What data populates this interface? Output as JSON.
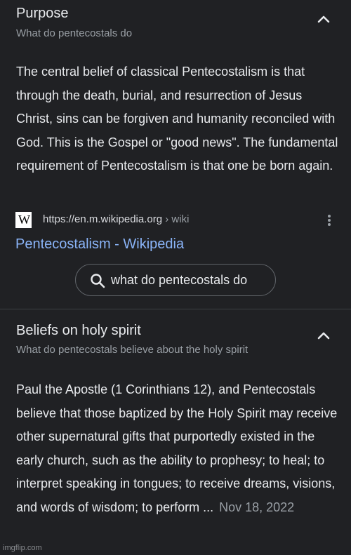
{
  "sections": [
    {
      "title": "Purpose",
      "subtitle": "What do pentecostals do",
      "body": "The central belief of classical Pentecostalism is that through the death, burial, and resurrection of Jesus Christ, sins can be forgiven and humanity reconciled with God. This is the Gospel or \"good news\". The fundamental requirement of Pentecostalism is that one be born again.",
      "source": {
        "favicon": "W",
        "url": "https://en.m.wikipedia.org",
        "crumb": " › wiki",
        "link_text": "Pentecostalism - Wikipedia"
      },
      "search_chip": "what do pentecostals do",
      "expanded": true
    },
    {
      "title": "Beliefs on holy spirit",
      "subtitle": "What do pentecostals believe about the holy spirit",
      "body": "Paul the Apostle (1 Corinthians 12), and Pentecostals believe that those baptized by the Holy Spirit may receive other supernatural gifts that purportedly existed in the early church, such as the ability to prophesy; to heal; to interpret speaking in tongues; to receive dreams, visions, and words of wisdom; to perform ...",
      "date": "Nov 18, 2022",
      "expanded": true
    }
  ],
  "icons": {
    "collapse": "chevron-up-icon",
    "more": "more-vert-icon",
    "search": "search-icon",
    "favicon": "wikipedia-icon"
  },
  "colors": {
    "background": "#202124",
    "text": "#e8eaed",
    "secondary": "#9aa0a6",
    "link": "#8ab4f8",
    "divider": "#3c4043"
  },
  "watermark": "imgflip.com"
}
